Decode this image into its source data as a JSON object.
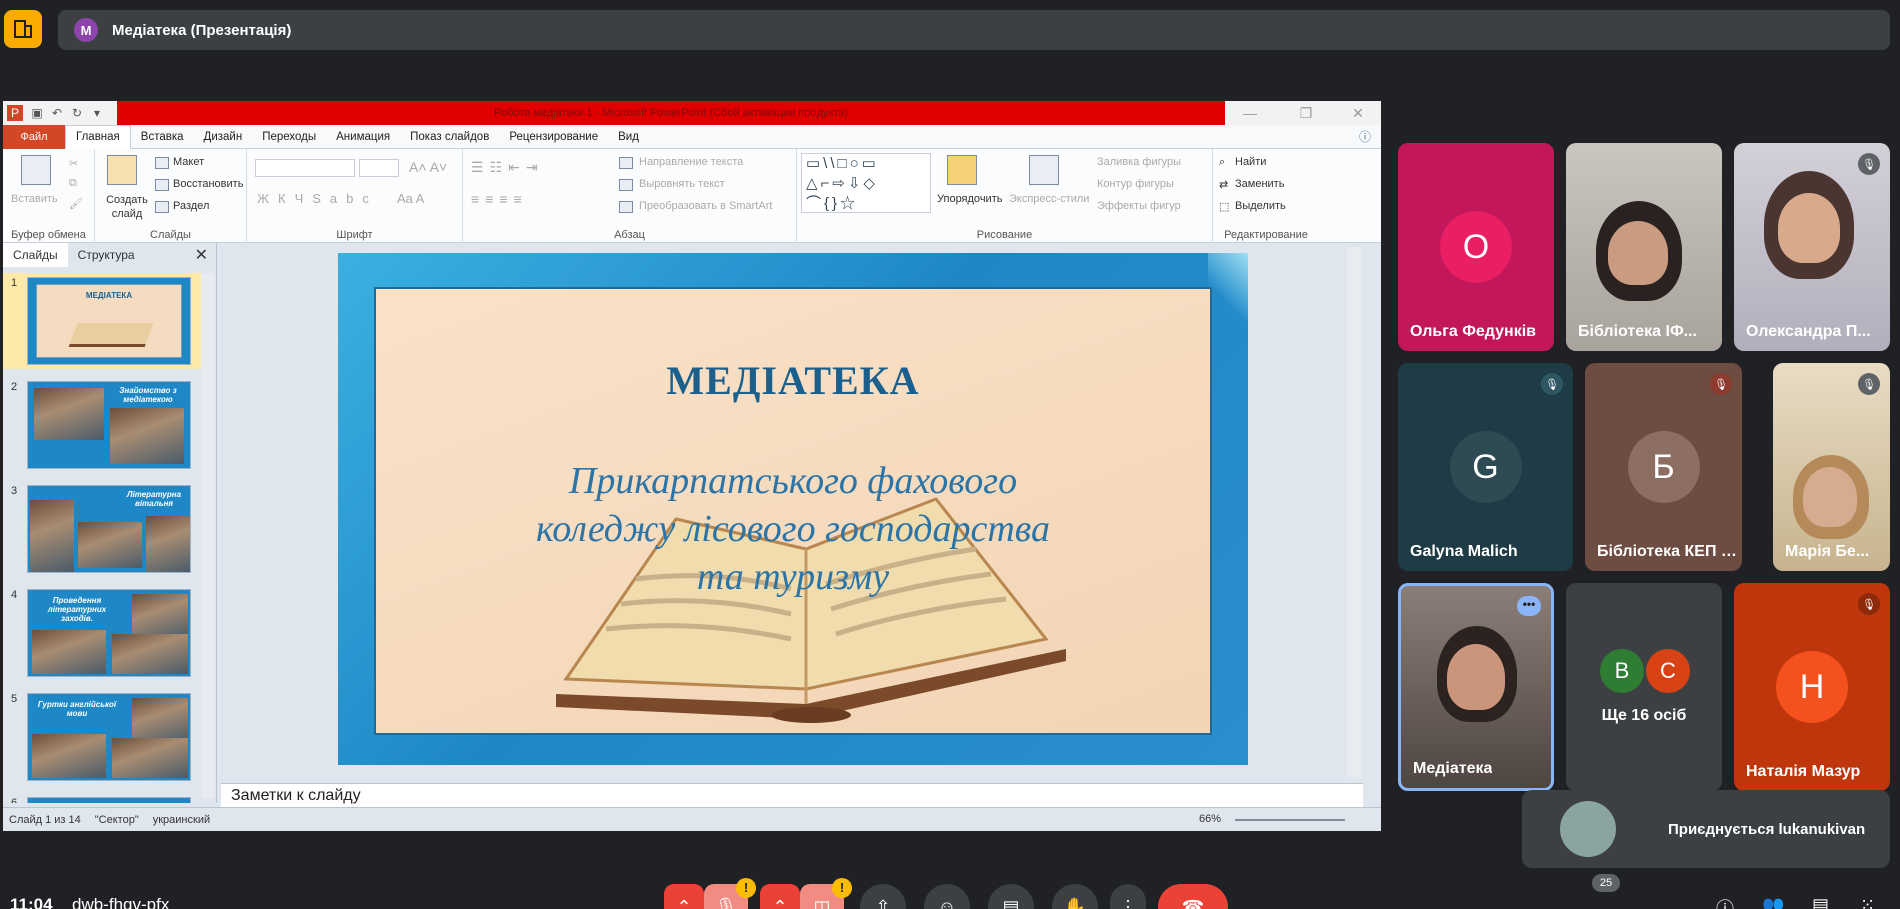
{
  "meet": {
    "presentation_title": "Медіатека (Презентація)",
    "presenter_initial": "М",
    "clock": "11:04",
    "meeting_code": "dwb-fhqv-pfx",
    "participants_badge": "25",
    "toast_text": "Приєднується lukanukivan"
  },
  "ppt": {
    "window_title": "Робота медіатеки 1 - Microsoft PowerPoint (Сбой активации продукта)",
    "tabs": [
      "Файл",
      "Главная",
      "Вставка",
      "Дизайн",
      "Переходы",
      "Анимация",
      "Показ слайдов",
      "Рецензирование",
      "Вид"
    ],
    "groups": {
      "clipboard": "Буфер обмена",
      "slides": "Слайды",
      "font": "Шрифт",
      "paragraph": "Абзац",
      "drawing": "Рисование",
      "editing": "Редактирование"
    },
    "buttons": {
      "paste": "Вставить",
      "new_slide": "Создать слайд",
      "layout": "Макет",
      "reset": "Восстановить",
      "section": "Раздел",
      "text_direction": "Направление текста",
      "align_text": "Выровнять текст",
      "smartart": "Преобразовать в SmartArt",
      "arrange": "Упорядочить",
      "quick_styles": "Экспресс-стили",
      "shape_fill": "Заливка фигуры",
      "shape_outline": "Контур фигуры",
      "shape_effects": "Эффекты фигур",
      "find": "Найти",
      "replace": "Заменить",
      "select": "Выделить"
    },
    "pane_tabs": [
      "Слайды",
      "Структура"
    ],
    "thumbnails": [
      {
        "num": "1",
        "caption": "МЕДІАТЕКА"
      },
      {
        "num": "2",
        "caption": "Знайомство з медіатекою"
      },
      {
        "num": "3",
        "caption": "Літературна вітальня"
      },
      {
        "num": "4",
        "caption": "Проведення літературних заходів."
      },
      {
        "num": "5",
        "caption": "Гуртки англійської мови"
      },
      {
        "num": "6",
        "caption": ""
      }
    ],
    "slide": {
      "title": "МЕДІАТЕКА",
      "subtitle": "Прикарпатського фахового\nколеджу лісового господарства\nта туризму"
    },
    "notes_placeholder": "Заметки к слайду",
    "status": {
      "slide_of": "Слайд 1 из 14",
      "theme": "\"Сектор\"",
      "language": "украинский",
      "zoom": "66%"
    }
  },
  "tiles": [
    {
      "name": "Ольга Федунків",
      "initial": "О",
      "color": "#c2185b"
    },
    {
      "name": "Бібліотека ІФ...",
      "initial": "",
      "color": "#b7b3ac"
    },
    {
      "name": "Олександра П...",
      "initial": "",
      "color": "#b8b4c0"
    },
    {
      "name": "Galyna Malich",
      "initial": "G",
      "color": "#3c4043"
    },
    {
      "name": "Бібліотека КЕП І...",
      "initial": "Б",
      "color": "#6d4c41"
    },
    {
      "name": "Марія Бе...",
      "initial": "",
      "color": "#d7c9b0"
    },
    {
      "name": "Медіатека",
      "initial": "",
      "color": "#6a5a52"
    },
    {
      "name": "Ще 16 осіб",
      "initial_a": "B",
      "initial_b": "C",
      "color": "#3c4043"
    },
    {
      "name": "Наталія Мазур",
      "initial": "Н",
      "color": "#e64a19"
    }
  ],
  "colors": {
    "meet_bg": "#202124",
    "ppt_title_red": "#e00000",
    "file_tab": "#d24726",
    "end_call": "#ea4335",
    "warning": "#fbbc04"
  }
}
